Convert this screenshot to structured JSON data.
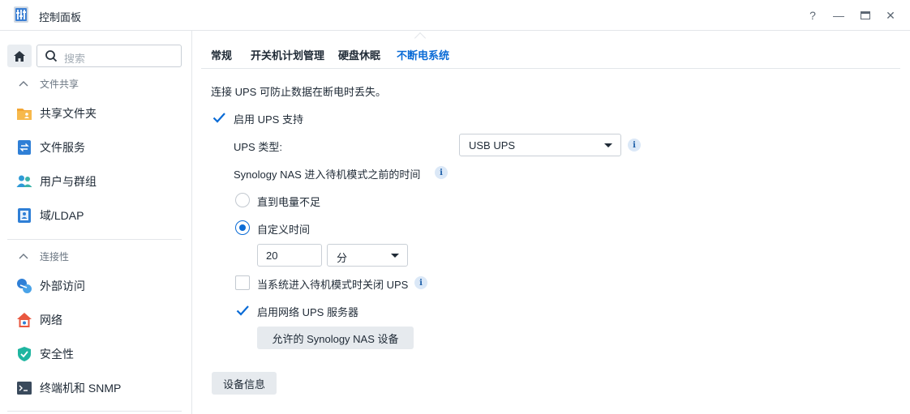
{
  "window": {
    "title": "控制面板",
    "controls": {
      "help": "?",
      "minimize": "—",
      "maximize": "▭",
      "close": "✕"
    }
  },
  "sidebar": {
    "search_placeholder": "搜索",
    "groups": [
      {
        "label": "文件共享",
        "items": [
          {
            "label": "共享文件夹",
            "icon": "shared-folder-icon"
          },
          {
            "label": "文件服务",
            "icon": "file-services-icon"
          },
          {
            "label": "用户与群组",
            "icon": "users-groups-icon"
          },
          {
            "label": "域/LDAP",
            "icon": "domain-ldap-icon"
          }
        ]
      },
      {
        "label": "连接性",
        "items": [
          {
            "label": "外部访问",
            "icon": "external-access-icon"
          },
          {
            "label": "网络",
            "icon": "network-icon"
          },
          {
            "label": "安全性",
            "icon": "security-icon"
          },
          {
            "label": "终端机和 SNMP",
            "icon": "terminal-snmp-icon"
          }
        ]
      }
    ]
  },
  "tabs": [
    {
      "label": "常规",
      "active": false
    },
    {
      "label": "开关机计划管理",
      "active": false
    },
    {
      "label": "硬盘休眠",
      "active": false
    },
    {
      "label": "不断电系统",
      "active": true
    }
  ],
  "ups": {
    "description": "连接 UPS 可防止数据在断电时丢失。",
    "enable_label": "启用 UPS 支持",
    "enable_checked": true,
    "type_label": "UPS 类型:",
    "type_value": "USB UPS",
    "standby_label": "Synology NAS 进入待机模式之前的时间",
    "option_until_low": "直到电量不足",
    "option_custom": "自定义时间",
    "custom_selected": true,
    "custom_value": "20",
    "custom_unit": "分",
    "shutdown_ups_label": "当系统进入待机模式时关闭 UPS",
    "shutdown_ups_checked": false,
    "network_server_label": "启用网络 UPS 服务器",
    "network_server_checked": true,
    "allowed_devices_button": "允许的 Synology NAS 设备",
    "device_info_button": "设备信息"
  },
  "colors": {
    "accent": "#0a6bd6",
    "border": "#e3e6ea",
    "text": "#1f2a36"
  }
}
